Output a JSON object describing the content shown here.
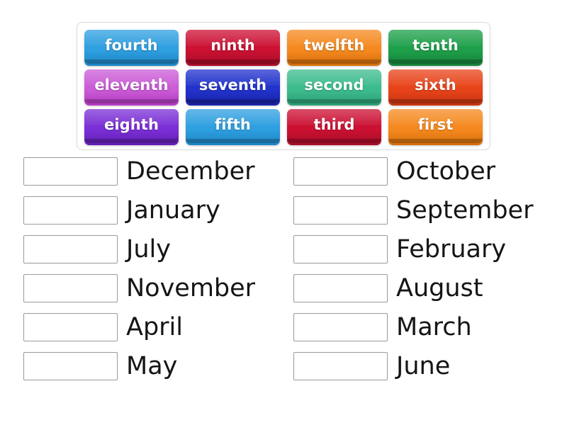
{
  "activity": {
    "type": "match-up",
    "tile_rows": [
      [
        {
          "label": "fourth",
          "color": "#2E9FE0",
          "color_dark": "#1E86C4"
        },
        {
          "label": "ninth",
          "color": "#CC1133",
          "color_dark": "#A80D28"
        },
        {
          "label": "twelfth",
          "color": "#F5891F",
          "color_dark": "#D66F0C"
        },
        {
          "label": "tenth",
          "color": "#1EA04A",
          "color_dark": "#16833B"
        }
      ],
      [
        {
          "label": "eleventh",
          "color": "#CB5BD6",
          "color_dark": "#B33CC0"
        },
        {
          "label": "seventh",
          "color": "#2233CC",
          "color_dark": "#1823A6"
        },
        {
          "label": "second",
          "color": "#3CBC8D",
          "color_dark": "#2DA076"
        },
        {
          "label": "sixth",
          "color": "#E8441A",
          "color_dark": "#C63512"
        }
      ],
      [
        {
          "label": "eighth",
          "color": "#7B2FD6",
          "color_dark": "#631FB5"
        },
        {
          "label": "fifth",
          "color": "#2E9FE0",
          "color_dark": "#1E86C4"
        },
        {
          "label": "third",
          "color": "#CC1133",
          "color_dark": "#A80D28"
        },
        {
          "label": "first",
          "color": "#F5891F",
          "color_dark": "#D66F0C"
        }
      ]
    ],
    "answer_columns": [
      {
        "items": [
          {
            "month": "December"
          },
          {
            "month": "January"
          },
          {
            "month": "July"
          },
          {
            "month": "November"
          },
          {
            "month": "April"
          },
          {
            "month": "May"
          }
        ]
      },
      {
        "items": [
          {
            "month": "October"
          },
          {
            "month": "September"
          },
          {
            "month": "February"
          },
          {
            "month": "August"
          },
          {
            "month": "March"
          },
          {
            "month": "June"
          }
        ]
      }
    ]
  }
}
